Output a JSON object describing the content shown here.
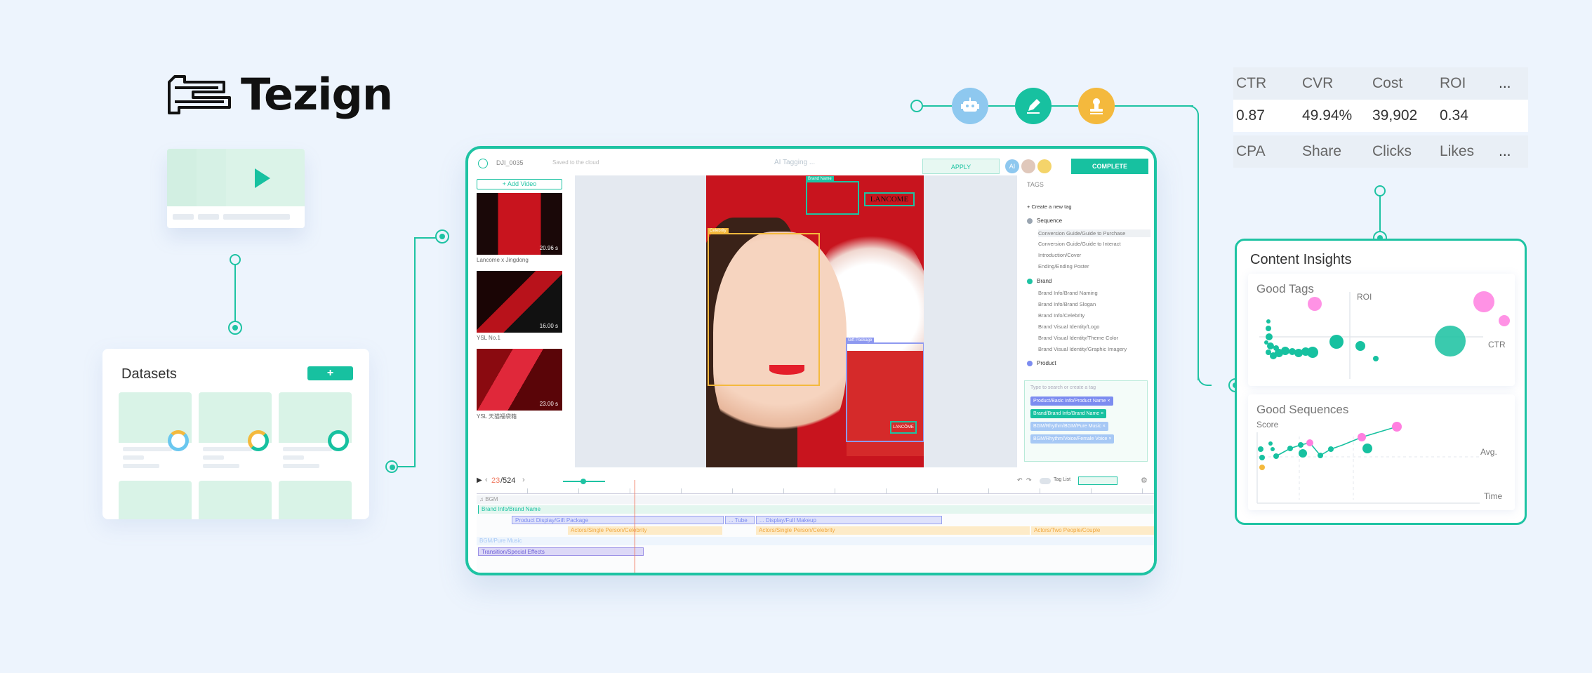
{
  "brand": {
    "name": "Tezign"
  },
  "colors": {
    "accent": "#17c1a0",
    "accent_line": "#1ec3a3",
    "bg": "#edf4fd",
    "robot": "#8ec8ef",
    "pen": "#17c1a0",
    "stamp": "#f4b93d"
  },
  "datasets": {
    "title": "Datasets",
    "add_label": "+"
  },
  "tools": {
    "icons": [
      "robot-icon",
      "pen-icon",
      "stamp-icon"
    ]
  },
  "editor": {
    "filename": "DJI_0035",
    "saved": "Saved to the cloud",
    "tagging": "AI Tagging ...",
    "apply_label": "APPLY",
    "avatar_ai": "AI",
    "complete_label": "COMPLETE",
    "add_video": "+ Add Video",
    "videos": [
      {
        "label": "Lancome x Jingdong",
        "duration": "20.96 s"
      },
      {
        "label": "YSL No.1",
        "duration": "16.00 s"
      },
      {
        "label": "YSL 天猫福袋箱",
        "duration": "23.00 s"
      }
    ],
    "detections": {
      "brand_name": "Brand Name",
      "gift_package": "Gift Package",
      "person": "Celebrity",
      "lancome": "LANCOME",
      "lancome_tag": "LANCÔME"
    },
    "tags": {
      "header": "TAGS",
      "create": "+ Create a new tag",
      "groups": [
        {
          "name": "Sequence",
          "items": [
            "Conversion Guide/Guide to Purchase",
            "Conversion Guide/Guide to Interact",
            "Introduction/Cover",
            "Ending/Ending Poster"
          ]
        },
        {
          "name": "Brand",
          "items": [
            "Brand Info/Brand Naming",
            "Brand Info/Brand Slogan",
            "Brand Info/Celebrity",
            "Brand Visual Identity/Logo",
            "Brand Visual Identity/Theme Color",
            "Brand Visual Identity/Graphic Imagery"
          ]
        },
        {
          "name": "Product",
          "items": []
        }
      ],
      "search_placeholder": "Type to search or create a tag",
      "chips": [
        "Product/Basic Info/Product Name ×",
        "Brand/Brand Info/Brand Name ×",
        "BGM/Rhythm/BGM/Pure Music ×",
        "BGM/Rhythm/Voice/Female Voice ×"
      ]
    },
    "frame": {
      "current": "23",
      "total": "/524"
    },
    "tag_list_label": "Tag List",
    "tracks": {
      "bgm": "♫ BGM",
      "brand": "Brand Info/Brand Name",
      "product": "Product Display/Gift Package",
      "tube": "... Tube",
      "makeup": "... Display/Full Makeup",
      "actors1": "Actors/Single Person/Celebrity",
      "actors2": "Actors/Single Person/Celebrity",
      "actors3": "Actors/Two People/Couple",
      "bgm_music": "BGM/Pure Music",
      "transition": "Transition/Special Effects"
    }
  },
  "metrics": {
    "headers": [
      "CTR",
      "CVR",
      "Cost",
      "ROI",
      "..."
    ],
    "values": [
      "0.87",
      "49.94%",
      "39,902",
      "0.34"
    ],
    "more": [
      "CPA",
      "Share",
      "Clicks",
      "Likes",
      "..."
    ]
  },
  "insights": {
    "title": "Content Insights",
    "good_tags": {
      "title": "Good Tags",
      "y_label": "ROI",
      "x_label": "CTR"
    },
    "good_sequences": {
      "title": "Good Sequences",
      "y_label": "Score",
      "avg_label": "Avg.",
      "x_label": "Time"
    }
  }
}
